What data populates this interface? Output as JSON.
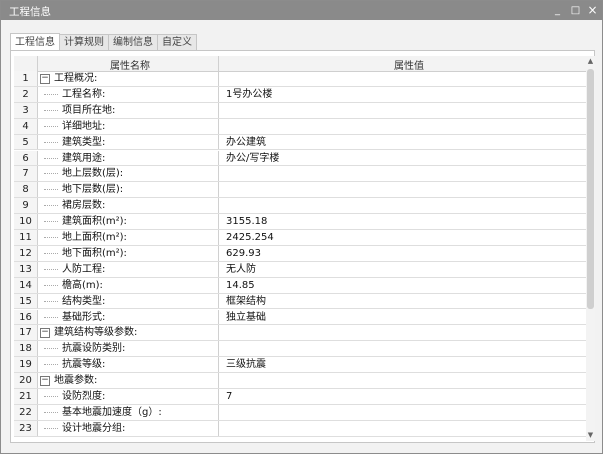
{
  "window": {
    "title": "工程信息",
    "minimize_label": "_",
    "maximize_label": "□",
    "close_label": "×"
  },
  "tabs": [
    "工程信息",
    "计算规则",
    "编制信息",
    "自定义"
  ],
  "table": {
    "headers": {
      "name": "属性名称",
      "value": "属性值"
    },
    "rows": [
      {
        "num": "1",
        "name": "工程概况:",
        "value": "",
        "group": true,
        "expander": "−"
      },
      {
        "num": "2",
        "name": "工程名称:",
        "value": "1号办公楼",
        "group": false
      },
      {
        "num": "3",
        "name": "项目所在地:",
        "value": "",
        "group": false
      },
      {
        "num": "4",
        "name": "详细地址:",
        "value": "",
        "group": false
      },
      {
        "num": "5",
        "name": "建筑类型:",
        "value": "办公建筑",
        "group": false
      },
      {
        "num": "6",
        "name": "建筑用途:",
        "value": "办公/写字楼",
        "group": false
      },
      {
        "num": "7",
        "name": "地上层数(层):",
        "value": "",
        "group": false
      },
      {
        "num": "8",
        "name": "地下层数(层):",
        "value": "",
        "group": false
      },
      {
        "num": "9",
        "name": "裙房层数:",
        "value": "",
        "group": false
      },
      {
        "num": "10",
        "name": "建筑面积(m²):",
        "value": "3155.18",
        "group": false
      },
      {
        "num": "11",
        "name": "地上面积(m²):",
        "value": "2425.254",
        "group": false
      },
      {
        "num": "12",
        "name": "地下面积(m²):",
        "value": "629.93",
        "group": false
      },
      {
        "num": "13",
        "name": "人防工程:",
        "value": "无人防",
        "group": false
      },
      {
        "num": "14",
        "name": "檐高(m):",
        "value": "14.85",
        "group": false
      },
      {
        "num": "15",
        "name": "结构类型:",
        "value": "框架结构",
        "group": false
      },
      {
        "num": "16",
        "name": "基础形式:",
        "value": "独立基础",
        "group": false
      },
      {
        "num": "17",
        "name": "建筑结构等级参数:",
        "value": "",
        "group": true,
        "expander": "−"
      },
      {
        "num": "18",
        "name": "抗震设防类别:",
        "value": "",
        "group": false
      },
      {
        "num": "19",
        "name": "抗震等级:",
        "value": "三级抗震",
        "group": false
      },
      {
        "num": "20",
        "name": "地震参数:",
        "value": "",
        "group": true,
        "expander": "−"
      },
      {
        "num": "21",
        "name": "设防烈度:",
        "value": "7",
        "group": false
      },
      {
        "num": "22",
        "name": "基本地震加速度（g）:",
        "value": "",
        "group": false
      },
      {
        "num": "23",
        "name": "设计地震分组:",
        "value": "",
        "group": false
      }
    ]
  },
  "scrollbar": {
    "up_label": "▲",
    "down_label": "▼"
  }
}
